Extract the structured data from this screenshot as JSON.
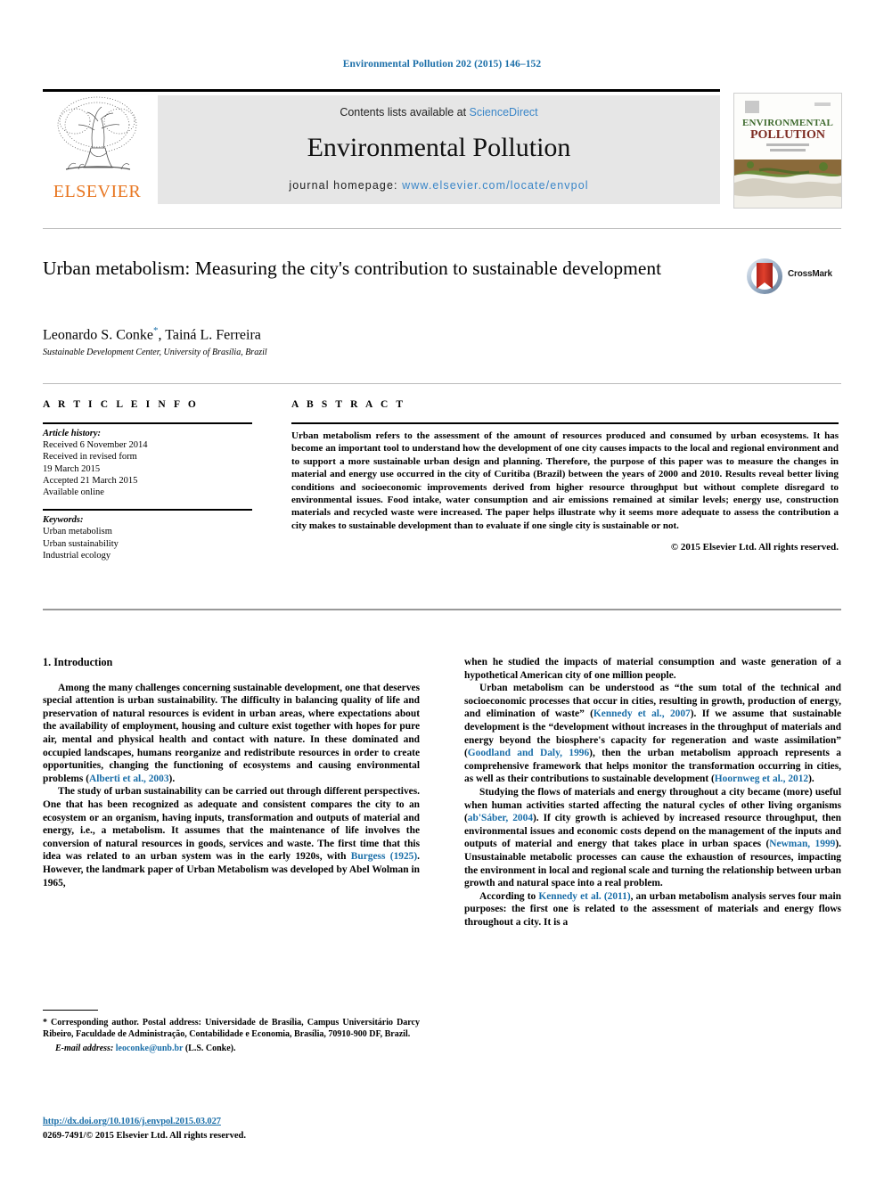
{
  "running_head": "Environmental Pollution 202 (2015) 146–152",
  "masthead": {
    "contents_prefix": "Contents lists available at ",
    "sciencedirect": "ScienceDirect",
    "journal_title": "Environmental Pollution",
    "homepage_prefix": "journal homepage: ",
    "homepage_url": "www.elsevier.com/locate/envpol",
    "publisher": "ELSEVIER",
    "cover_title_line1": "ENVIRONMENTAL",
    "cover_title_line2": "POLLUTION",
    "accent_blue": "#3a86c8",
    "elsevier_orange": "#E87722"
  },
  "article": {
    "title": "Urban metabolism: Measuring the city's contribution to sustainable development",
    "authors": "Leonardo S. Conke",
    "authors_rest": ", Tainá L. Ferreira",
    "corresponding_marker": "*",
    "affiliation": "Sustainable Development Center, University of Brasília, Brazil",
    "crossmark_label": "CrossMark"
  },
  "article_info": {
    "heading": "A R T I C L E   I N F O",
    "history_label": "Article history:",
    "history": [
      "Received 6 November 2014",
      "Received in revised form",
      "19 March 2015",
      "Accepted 21 March 2015",
      "Available online"
    ],
    "keywords_label": "Keywords:",
    "keywords": [
      "Urban metabolism",
      "Urban sustainability",
      "Industrial ecology"
    ]
  },
  "abstract": {
    "heading": "A B S T R A C T",
    "body": "Urban metabolism refers to the assessment of the amount of resources produced and consumed by urban ecosystems. It has become an important tool to understand how the development of one city causes impacts to the local and regional environment and to support a more sustainable urban design and planning. Therefore, the purpose of this paper was to measure the changes in material and energy use occurred in the city of Curitiba (Brazil) between the years of 2000 and 2010. Results reveal better living conditions and socioeconomic improvements derived from higher resource throughput but without complete disregard to environmental issues. Food intake, water consumption and air emissions remained at similar levels; energy use, construction materials and recycled waste were increased. The paper helps illustrate why it seems more adequate to assess the contribution a city makes to sustainable development than to evaluate if one single city is sustainable or not.",
    "copyright": "© 2015 Elsevier Ltd. All rights reserved."
  },
  "body": {
    "section_number_title": "1. Introduction",
    "left_paragraphs": [
      {
        "parts": [
          {
            "t": "Among the many challenges concerning sustainable development, one that deserves special attention is urban sustainability. The difficulty in balancing quality of life and preservation of natural resources is evident in urban areas, where expectations about the availability of employment, housing and culture exist together with hopes for pure air, mental and physical health and contact with nature. In these dominated and occupied landscapes, humans reorganize and redistribute resources in order to create opportunities, changing the functioning of ecosystems and causing environmental problems ("
          },
          {
            "t": "Alberti et al., 2003",
            "ref": true
          },
          {
            "t": ")."
          }
        ]
      },
      {
        "parts": [
          {
            "t": "The study of urban sustainability can be carried out through different perspectives. One that has been recognized as adequate and consistent compares the city to an ecosystem or an organism, having inputs, transformation and outputs of material and energy, i.e., a metabolism. It assumes that the maintenance of life involves the conversion of natural resources in goods, services and waste. The first time that this idea was related to an urban system was in the early 1920s, with "
          },
          {
            "t": "Burgess (1925)",
            "ref": true
          },
          {
            "t": ". However, the landmark paper of Urban Metabolism was developed by Abel Wolman in 1965,"
          }
        ]
      }
    ],
    "right_paragraphs": [
      {
        "parts": [
          {
            "t": "when he studied the impacts of material consumption and waste generation of a hypothetical American city of one million people.",
            "noindent": true
          }
        ]
      },
      {
        "parts": [
          {
            "t": "Urban metabolism can be understood as “the sum total of the technical and socioeconomic processes that occur in cities, resulting in growth, production of energy, and elimination of waste” ("
          },
          {
            "t": "Kennedy et al., 2007",
            "ref": true
          },
          {
            "t": "). If we assume that sustainable development is the “development without increases in the throughput of materials and energy beyond the biosphere's capacity for regeneration and waste assimilation” ("
          },
          {
            "t": "Goodland and Daly, 1996",
            "ref": true
          },
          {
            "t": "), then the urban metabolism approach represents a comprehensive framework that helps monitor the transformation occurring in cities, as well as their contributions to sustainable development ("
          },
          {
            "t": "Hoornweg et al., 2012",
            "ref": true
          },
          {
            "t": ")."
          }
        ]
      },
      {
        "parts": [
          {
            "t": "Studying the flows of materials and energy throughout a city became (more) useful when human activities started affecting the natural cycles of other living organisms ("
          },
          {
            "t": "ab'Sáber, 2004",
            "ref": true
          },
          {
            "t": "). If city growth is achieved by increased resource throughput, then environmental issues and economic costs depend on the management of the inputs and outputs of material and energy that takes place in urban spaces ("
          },
          {
            "t": "Newman, 1999",
            "ref": true
          },
          {
            "t": "). Unsustainable metabolic processes can cause the exhaustion of resources, impacting the environment in local and regional scale and turning the relationship between urban growth and natural space into a real problem."
          }
        ]
      },
      {
        "parts": [
          {
            "t": "According to "
          },
          {
            "t": "Kennedy et al. (2011)",
            "ref": true
          },
          {
            "t": ", an urban metabolism analysis serves four main purposes: the first one is related to the assessment of materials and energy flows throughout a city. It is a"
          }
        ]
      }
    ]
  },
  "footnote": {
    "marker": "*",
    "text": " Corresponding author. Postal address: Universidade de Brasília, Campus Universitário Darcy Ribeiro, Faculdade de Administração, Contabilidade e Economia, Brasília, 70910-900 DF, Brazil.",
    "email_label": "E-mail address:",
    "email": "leoconke@unb.br",
    "email_suffix": " (L.S. Conke)."
  },
  "footer": {
    "doi": "http://dx.doi.org/10.1016/j.envpol.2015.03.027",
    "issn_line": "0269-7491/© 2015 Elsevier Ltd. All rights reserved."
  }
}
